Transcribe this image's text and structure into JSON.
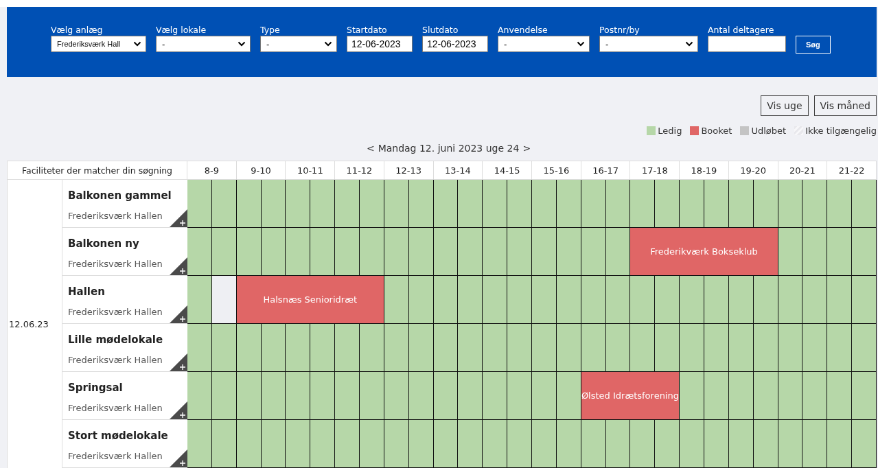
{
  "filters": [
    {
      "kind": "select",
      "label": "Vælg anlæg",
      "value": "Frederiksværk Hall"
    },
    {
      "kind": "select",
      "label": "Vælg lokale",
      "value": "-"
    },
    {
      "kind": "select",
      "label": "Type",
      "value": "-"
    },
    {
      "kind": "date",
      "label": "Startdato",
      "value": "12-06-2023"
    },
    {
      "kind": "date",
      "label": "Slutdato",
      "value": "12-06-2023"
    },
    {
      "kind": "select",
      "label": "Anvendelse",
      "value": "-"
    },
    {
      "kind": "select",
      "label": "Postnr/by",
      "value": "-"
    },
    {
      "kind": "input",
      "label": "Antal deltagere"
    }
  ],
  "search_button": "Søg",
  "view_buttons": [
    "Vis uge",
    "Vis måned"
  ],
  "legend": [
    {
      "label": "Ledig",
      "color": "#b6d7a8",
      "kind": "solid"
    },
    {
      "label": "Booket",
      "color": "#e06666",
      "kind": "solid"
    },
    {
      "label": "Udløbet",
      "color": "#c4c4c4",
      "kind": "solid"
    },
    {
      "label": "Ikke tilgængelig",
      "color": "#e8e8ec",
      "kind": "hatched"
    }
  ],
  "nav": {
    "prev": "<",
    "title": "Mandag 12. juni 2023 uge 24",
    "next": ">"
  },
  "table": {
    "facility_header": "Faciliteter der matcher din søgning",
    "hours": [
      "8-9",
      "9-10",
      "10-11",
      "11-12",
      "12-13",
      "13-14",
      "14-15",
      "15-16",
      "16-17",
      "17-18",
      "18-19",
      "19-20",
      "20-21",
      "21-22"
    ],
    "date": "12.06.23",
    "rows": [
      {
        "name": "Balkonen gammel",
        "venue": "Frederiksværk Hallen",
        "cells": [
          {
            "kind": "free"
          },
          {
            "kind": "free"
          },
          {
            "kind": "free"
          },
          {
            "kind": "free"
          },
          {
            "kind": "free"
          },
          {
            "kind": "free"
          },
          {
            "kind": "free"
          },
          {
            "kind": "free"
          },
          {
            "kind": "free"
          },
          {
            "kind": "free"
          },
          {
            "kind": "free"
          },
          {
            "kind": "free"
          },
          {
            "kind": "free"
          },
          {
            "kind": "free"
          },
          {
            "kind": "free"
          },
          {
            "kind": "free"
          },
          {
            "kind": "free"
          },
          {
            "kind": "free"
          },
          {
            "kind": "free"
          },
          {
            "kind": "free"
          },
          {
            "kind": "free"
          },
          {
            "kind": "free"
          },
          {
            "kind": "free"
          },
          {
            "kind": "free"
          },
          {
            "kind": "free"
          },
          {
            "kind": "free"
          },
          {
            "kind": "free"
          },
          {
            "kind": "free"
          }
        ]
      },
      {
        "name": "Balkonen ny",
        "venue": "Frederiksværk Hallen",
        "cells": [
          {
            "kind": "free"
          },
          {
            "kind": "free"
          },
          {
            "kind": "free"
          },
          {
            "kind": "free"
          },
          {
            "kind": "free"
          },
          {
            "kind": "free"
          },
          {
            "kind": "free"
          },
          {
            "kind": "free"
          },
          {
            "kind": "free"
          },
          {
            "kind": "free"
          },
          {
            "kind": "free"
          },
          {
            "kind": "free"
          },
          {
            "kind": "free"
          },
          {
            "kind": "free"
          },
          {
            "kind": "free"
          },
          {
            "kind": "free"
          },
          {
            "kind": "free"
          },
          {
            "kind": "free"
          },
          {
            "kind": "booked",
            "label": "Frederikværk Bokseklub"
          },
          {
            "kind": "booked"
          },
          {
            "kind": "booked"
          },
          {
            "kind": "booked"
          },
          {
            "kind": "booked"
          },
          {
            "kind": "booked"
          },
          {
            "kind": "free"
          },
          {
            "kind": "free"
          },
          {
            "kind": "free"
          },
          {
            "kind": "free"
          }
        ]
      },
      {
        "name": "Hallen",
        "venue": "Frederiksværk Hallen",
        "cells": [
          {
            "kind": "free"
          },
          {
            "kind": "unavailable"
          },
          {
            "kind": "booked",
            "label": "Halsnæs Senioridræt"
          },
          {
            "kind": "booked"
          },
          {
            "kind": "booked"
          },
          {
            "kind": "booked"
          },
          {
            "kind": "booked"
          },
          {
            "kind": "booked"
          },
          {
            "kind": "free"
          },
          {
            "kind": "free"
          },
          {
            "kind": "free"
          },
          {
            "kind": "free"
          },
          {
            "kind": "free"
          },
          {
            "kind": "free"
          },
          {
            "kind": "free"
          },
          {
            "kind": "free"
          },
          {
            "kind": "free"
          },
          {
            "kind": "free"
          },
          {
            "kind": "free"
          },
          {
            "kind": "free"
          },
          {
            "kind": "free"
          },
          {
            "kind": "free"
          },
          {
            "kind": "free"
          },
          {
            "kind": "free"
          },
          {
            "kind": "free"
          },
          {
            "kind": "free"
          },
          {
            "kind": "free"
          },
          {
            "kind": "free"
          }
        ]
      },
      {
        "name": "Lille mødelokale",
        "venue": "Frederiksværk Hallen",
        "cells": [
          {
            "kind": "free"
          },
          {
            "kind": "free"
          },
          {
            "kind": "free"
          },
          {
            "kind": "free"
          },
          {
            "kind": "free"
          },
          {
            "kind": "free"
          },
          {
            "kind": "free"
          },
          {
            "kind": "free"
          },
          {
            "kind": "free"
          },
          {
            "kind": "free"
          },
          {
            "kind": "free"
          },
          {
            "kind": "free"
          },
          {
            "kind": "free"
          },
          {
            "kind": "free"
          },
          {
            "kind": "free"
          },
          {
            "kind": "free"
          },
          {
            "kind": "free"
          },
          {
            "kind": "free"
          },
          {
            "kind": "free"
          },
          {
            "kind": "free"
          },
          {
            "kind": "free"
          },
          {
            "kind": "free"
          },
          {
            "kind": "free"
          },
          {
            "kind": "free"
          },
          {
            "kind": "free"
          },
          {
            "kind": "free"
          },
          {
            "kind": "free"
          },
          {
            "kind": "free"
          }
        ]
      },
      {
        "name": "Springsal",
        "venue": "Frederiksværk Hallen",
        "cells": [
          {
            "kind": "free"
          },
          {
            "kind": "free"
          },
          {
            "kind": "free"
          },
          {
            "kind": "free"
          },
          {
            "kind": "free"
          },
          {
            "kind": "free"
          },
          {
            "kind": "free"
          },
          {
            "kind": "free"
          },
          {
            "kind": "free"
          },
          {
            "kind": "free"
          },
          {
            "kind": "free"
          },
          {
            "kind": "free"
          },
          {
            "kind": "free"
          },
          {
            "kind": "free"
          },
          {
            "kind": "free"
          },
          {
            "kind": "free"
          },
          {
            "kind": "booked",
            "label": "Ølsted Idrætsforening"
          },
          {
            "kind": "booked"
          },
          {
            "kind": "booked"
          },
          {
            "kind": "booked"
          },
          {
            "kind": "free"
          },
          {
            "kind": "free"
          },
          {
            "kind": "free"
          },
          {
            "kind": "free"
          },
          {
            "kind": "free"
          },
          {
            "kind": "free"
          },
          {
            "kind": "free"
          },
          {
            "kind": "free"
          }
        ]
      },
      {
        "name": "Stort mødelokale",
        "venue": "Frederiksværk Hallen",
        "cells": [
          {
            "kind": "free"
          },
          {
            "kind": "free"
          },
          {
            "kind": "free"
          },
          {
            "kind": "free"
          },
          {
            "kind": "free"
          },
          {
            "kind": "free"
          },
          {
            "kind": "free"
          },
          {
            "kind": "free"
          },
          {
            "kind": "free"
          },
          {
            "kind": "free"
          },
          {
            "kind": "free"
          },
          {
            "kind": "free"
          },
          {
            "kind": "free"
          },
          {
            "kind": "free"
          },
          {
            "kind": "free"
          },
          {
            "kind": "free"
          },
          {
            "kind": "free"
          },
          {
            "kind": "free"
          },
          {
            "kind": "free"
          },
          {
            "kind": "free"
          },
          {
            "kind": "free"
          },
          {
            "kind": "free"
          },
          {
            "kind": "free"
          },
          {
            "kind": "free"
          },
          {
            "kind": "free"
          },
          {
            "kind": "free"
          },
          {
            "kind": "free"
          },
          {
            "kind": "free"
          }
        ]
      }
    ]
  }
}
